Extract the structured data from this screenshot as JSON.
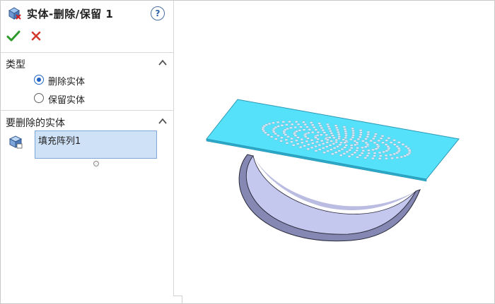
{
  "panel": {
    "title": "实体-删除/保留 1",
    "help_icon": "question-circle-icon",
    "help_glyph": "?",
    "ok_icon": "green-check-icon",
    "cancel_icon": "red-x-icon",
    "colors": {
      "ok": "#2e9a2e",
      "cancel": "#d23a2a",
      "selection_bg": "#cfe1f7",
      "radio_selected": "#1f5fc6"
    }
  },
  "type_section": {
    "label": "类型",
    "options": [
      {
        "label": "删除实体",
        "selected": true
      },
      {
        "label": "保留实体",
        "selected": false
      }
    ]
  },
  "bodies_section": {
    "label": "要删除的实体",
    "items": [
      "填充阵列1"
    ]
  },
  "viewport": {
    "plate_color": "#55e1f9",
    "curved_body_color": "#b7bbe6"
  }
}
